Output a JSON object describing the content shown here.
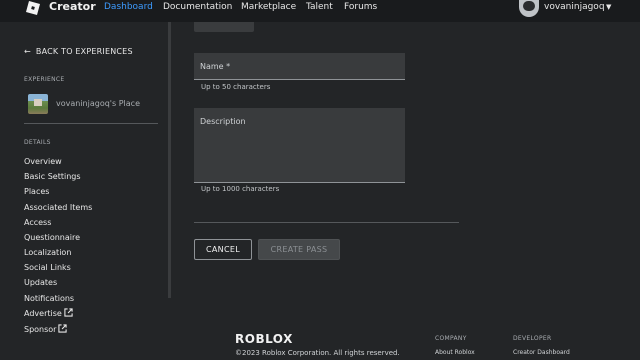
{
  "header": {
    "brand": "Creator",
    "nav": [
      "Dashboard",
      "Documentation",
      "Marketplace",
      "Talent",
      "Forums"
    ],
    "active": "Dashboard",
    "username": "vovaninjagoq"
  },
  "sidebar": {
    "back": "BACK TO EXPERIENCES",
    "experience_label": "EXPERIENCE",
    "experience_name": "vovaninjagoq's Place",
    "details_label": "DETAILS",
    "items": [
      "Overview",
      "Basic Settings",
      "Places",
      "Associated Items",
      "Access",
      "Questionnaire",
      "Localization",
      "Social Links",
      "Updates",
      "Notifications",
      "Advertise",
      "Sponsor"
    ]
  },
  "form": {
    "name_label": "Name *",
    "name_helper": "Up to 50 characters",
    "description_label": "Description",
    "description_helper": "Up to 1000 characters",
    "cancel": "CANCEL",
    "create": "CREATE PASS"
  },
  "footer": {
    "logo": "ROBLOX",
    "copyright": "©2023 Roblox Corporation. All rights reserved.",
    "col1_head": "COMPANY",
    "col1_link": "About Roblox",
    "col2_head": "DEVELOPER",
    "col2_link": "Creator Dashboard"
  },
  "colors": {
    "accent": "#3d9bff",
    "background": "#232527",
    "topbar": "#191b1d"
  }
}
